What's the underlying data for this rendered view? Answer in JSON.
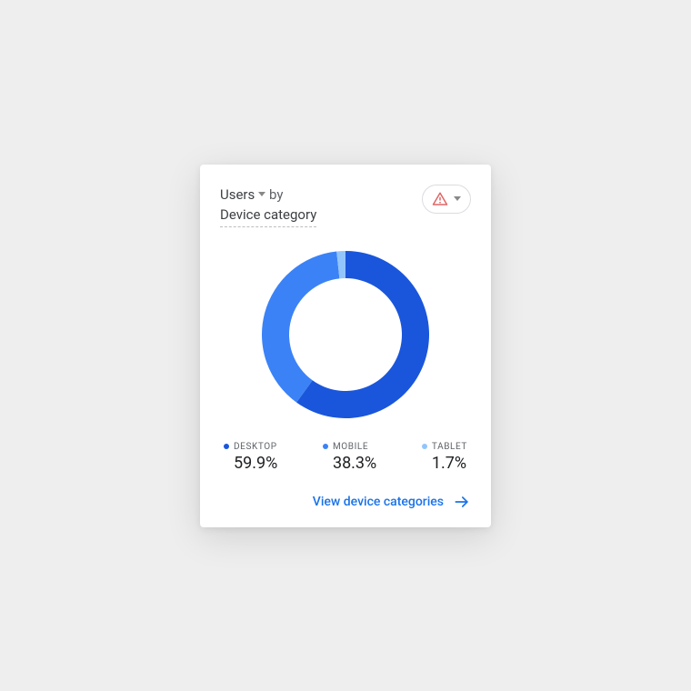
{
  "header": {
    "metric_label": "Users",
    "separator": "by",
    "dimension_label": "Device category"
  },
  "alert": {
    "icon_name": "warning-icon",
    "has_dropdown": true
  },
  "chart_data": {
    "type": "pie",
    "title": "Users by Device category",
    "series": [
      {
        "name": "DESKTOP",
        "value": 59.9,
        "color": "#1a56db"
      },
      {
        "name": "MOBILE",
        "value": 38.3,
        "color": "#3b82f6"
      },
      {
        "name": "TABLET",
        "value": 1.7,
        "color": "#93c5fd"
      }
    ]
  },
  "legend": [
    {
      "label": "DESKTOP",
      "value": "59.9%",
      "color": "#1a56db"
    },
    {
      "label": "MOBILE",
      "value": "38.3%",
      "color": "#3b82f6"
    },
    {
      "label": "TABLET",
      "value": "1.7%",
      "color": "#93c5fd"
    }
  ],
  "footer": {
    "link_label": "View device categories"
  },
  "colors": {
    "accent": "#1a73e8",
    "warning": "#d9534f"
  }
}
